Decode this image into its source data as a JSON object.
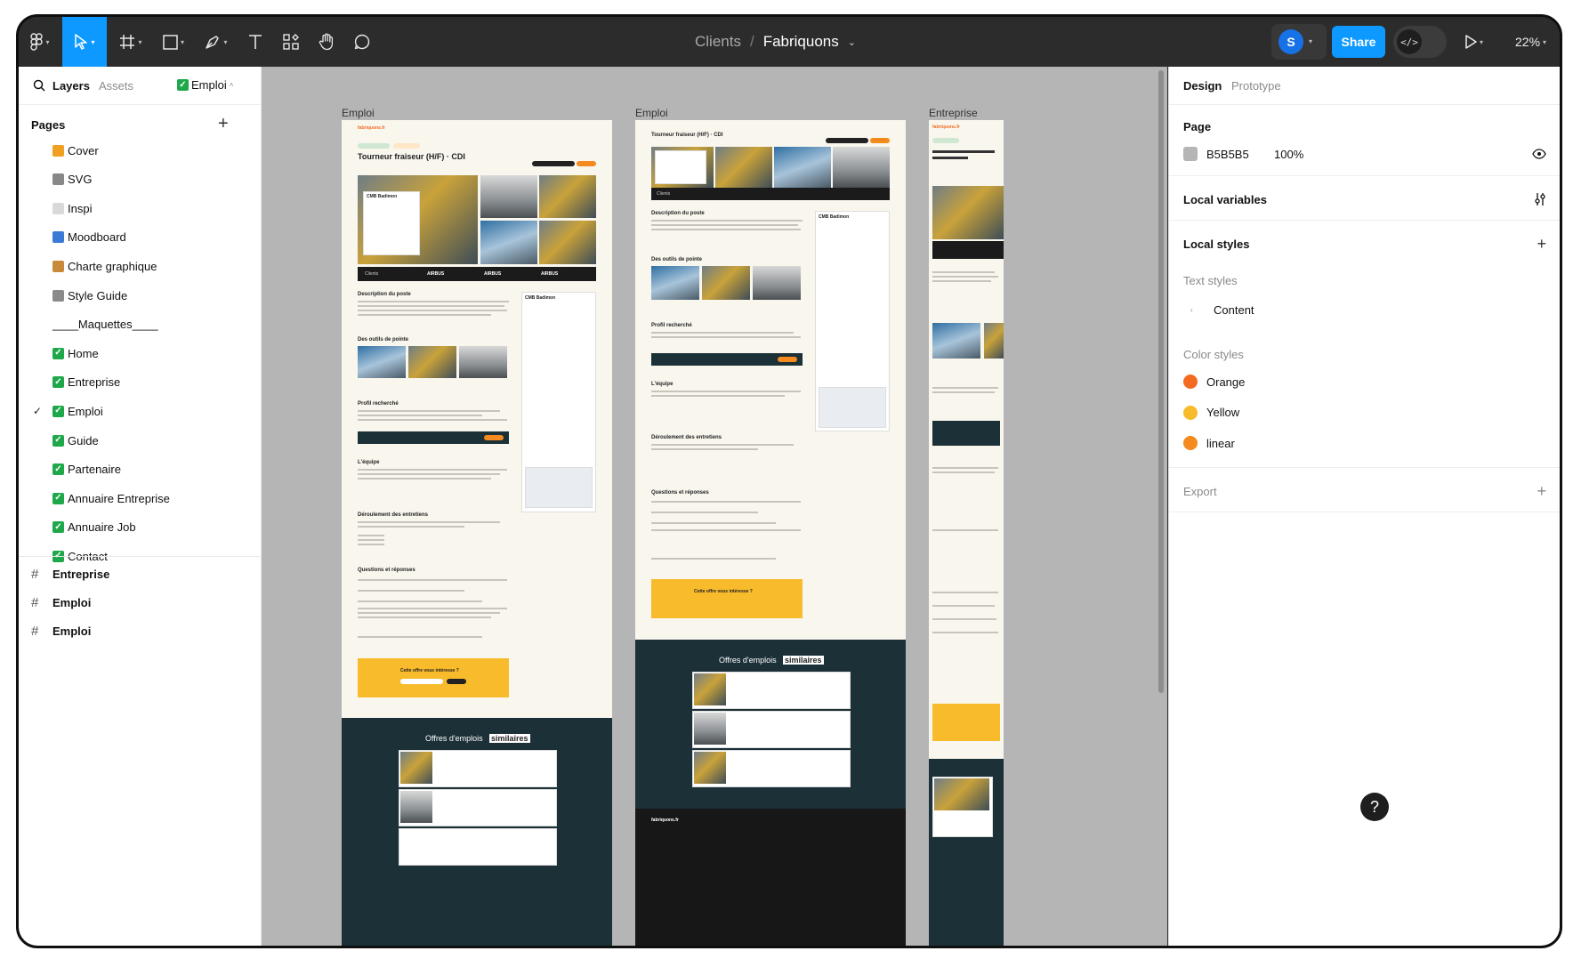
{
  "toolbar": {
    "breadcrumb_parent": "Clients",
    "breadcrumb_sep": "/",
    "file_name": "Fabriquons",
    "avatar_initial": "S",
    "share_label": "Share",
    "dev_icon": "</>",
    "zoom": "22%"
  },
  "left_panel": {
    "tab_layers": "Layers",
    "tab_assets": "Assets",
    "current_page": "Emploi",
    "pages_heading": "Pages",
    "pages": [
      {
        "label": "Cover",
        "icon": "cover-emoji-icon",
        "color": "#f0a020"
      },
      {
        "label": "SVG",
        "icon": "svg-emoji-icon",
        "color": "#888888"
      },
      {
        "label": "Inspi",
        "icon": "eyes-emoji-icon",
        "color": "#d9d9d9"
      },
      {
        "label": "Moodboard",
        "icon": "chart-emoji-icon",
        "color": "#3a7bd5"
      },
      {
        "label": "Charte graphique",
        "icon": "palette-emoji-icon",
        "color": "#c88a3a"
      },
      {
        "label": "Style Guide",
        "icon": "wrench-emoji-icon",
        "color": "#8a8a8a"
      },
      {
        "label": "____Maquettes____",
        "icon": "",
        "color": ""
      },
      {
        "label": "Home",
        "icon": "check-icon",
        "color": "#1fa84a"
      },
      {
        "label": "Entreprise",
        "icon": "check-icon",
        "color": "#1fa84a"
      },
      {
        "label": "Emploi",
        "icon": "check-icon",
        "color": "#1fa84a",
        "selected": true
      },
      {
        "label": "Guide",
        "icon": "check-icon",
        "color": "#1fa84a"
      },
      {
        "label": "Partenaire",
        "icon": "check-icon",
        "color": "#1fa84a"
      },
      {
        "label": "Annuaire Entreprise",
        "icon": "check-icon",
        "color": "#1fa84a"
      },
      {
        "label": "Annuaire Job",
        "icon": "check-icon",
        "color": "#1fa84a"
      },
      {
        "label": "Contact",
        "icon": "check-icon",
        "color": "#1fa84a"
      }
    ],
    "frames": [
      "Entreprise",
      "Emploi",
      "Emploi"
    ]
  },
  "canvas": {
    "background": "#B5B5B5",
    "frame_labels": [
      "Emploi",
      "Emploi",
      "Entreprise"
    ],
    "mini": {
      "logo": "fabriquons.fr",
      "job_title": "Tourneur fraiseur (H/F) · CDI",
      "job_title_short": "Tourneur fraiseur (H/F) · CDI",
      "desc": "Description du poste",
      "tools": "Des outils de pointe",
      "profile": "Profil recherché",
      "team": "L'équipe",
      "process": "Déroulement des entretiens",
      "faq": "Questions et réponses",
      "cta": "Cette offre vous intéresse ?",
      "similar_prefix": "Offres d'emplois",
      "similar_highlight": "similaires",
      "company": "CMB Badimon",
      "clients": "Clients",
      "brand": "AIRBUS"
    }
  },
  "right_panel": {
    "tab_design": "Design",
    "tab_prototype": "Prototype",
    "page_heading": "Page",
    "page_color": "B5B5B5",
    "page_opacity": "100%",
    "local_variables": "Local variables",
    "local_styles": "Local styles",
    "text_styles": "Text styles",
    "text_style_items": [
      "Content"
    ],
    "color_styles": "Color styles",
    "color_style_items": [
      {
        "label": "Orange",
        "color": "#f26b21"
      },
      {
        "label": "Yellow",
        "color": "#f8bb2b"
      },
      {
        "label": "linear",
        "color": "#f58a1f"
      }
    ],
    "export": "Export"
  },
  "help": "?"
}
